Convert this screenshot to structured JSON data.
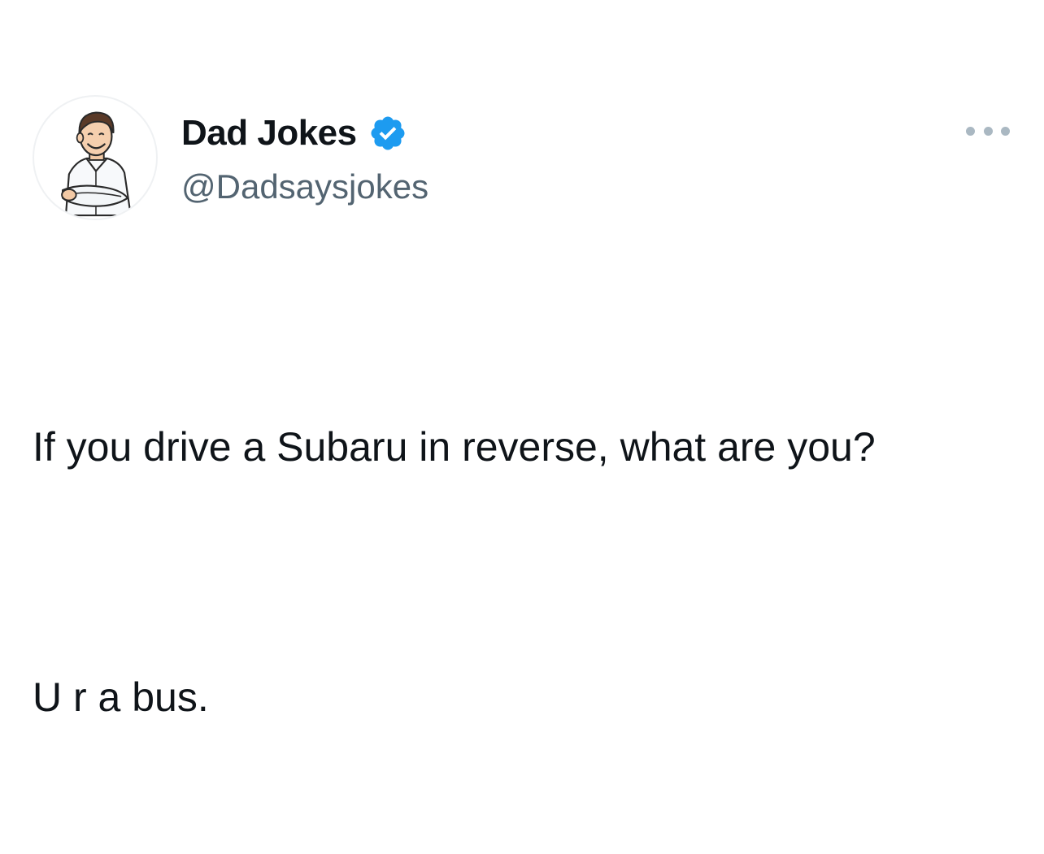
{
  "tweet": {
    "author": {
      "display_name": "Dad Jokes",
      "handle": "@Dadsaysjokes",
      "verified": true,
      "avatar_icon": "cartoon-dad-avatar-icon"
    },
    "body": {
      "paragraphs": [
        "If you drive a Subaru in reverse, what are you?",
        "U r a bus."
      ]
    },
    "menu_icon": "more-options-icon"
  },
  "colors": {
    "text_primary": "#0f1419",
    "text_secondary": "#536471",
    "verified_blue": "#1d9bf0",
    "more_dots": "#aab8c2",
    "background": "#ffffff"
  }
}
